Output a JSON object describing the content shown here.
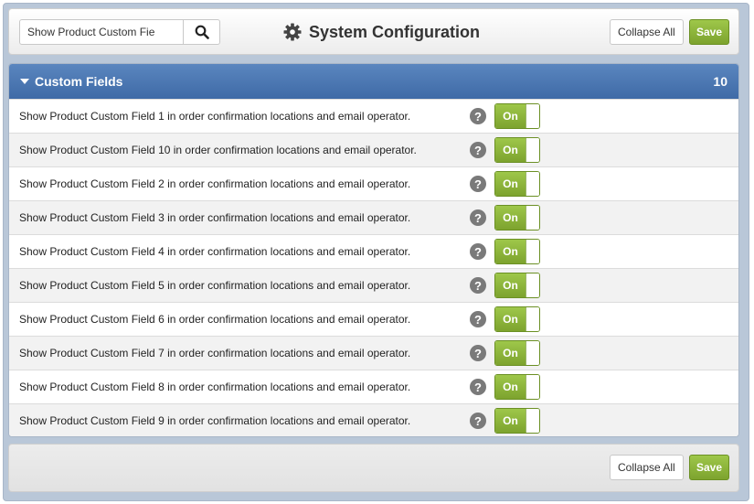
{
  "toolbar": {
    "search_value": "Show Product Custom Fie",
    "title": "System Configuration",
    "collapse_all_label": "Collapse All",
    "save_label": "Save"
  },
  "panel": {
    "title": "Custom Fields",
    "count": "10",
    "toggle_on_label": "On",
    "help_glyph": "?",
    "rows": [
      {
        "label": "Show Product Custom Field 1 in order confirmation locations and email operator."
      },
      {
        "label": "Show Product Custom Field 10 in order confirmation locations and email operator."
      },
      {
        "label": "Show Product Custom Field 2 in order confirmation locations and email operator."
      },
      {
        "label": "Show Product Custom Field 3 in order confirmation locations and email operator."
      },
      {
        "label": "Show Product Custom Field 4 in order confirmation locations and email operator."
      },
      {
        "label": "Show Product Custom Field 5 in order confirmation locations and email operator."
      },
      {
        "label": "Show Product Custom Field 6 in order confirmation locations and email operator."
      },
      {
        "label": "Show Product Custom Field 7 in order confirmation locations and email operator."
      },
      {
        "label": "Show Product Custom Field 8 in order confirmation locations and email operator."
      },
      {
        "label": "Show Product Custom Field 9 in order confirmation locations and email operator."
      }
    ]
  },
  "footer": {
    "collapse_all_label": "Collapse All",
    "save_label": "Save"
  },
  "colors": {
    "accent_green": "#8cb43b",
    "header_blue": "#4a76b0"
  }
}
